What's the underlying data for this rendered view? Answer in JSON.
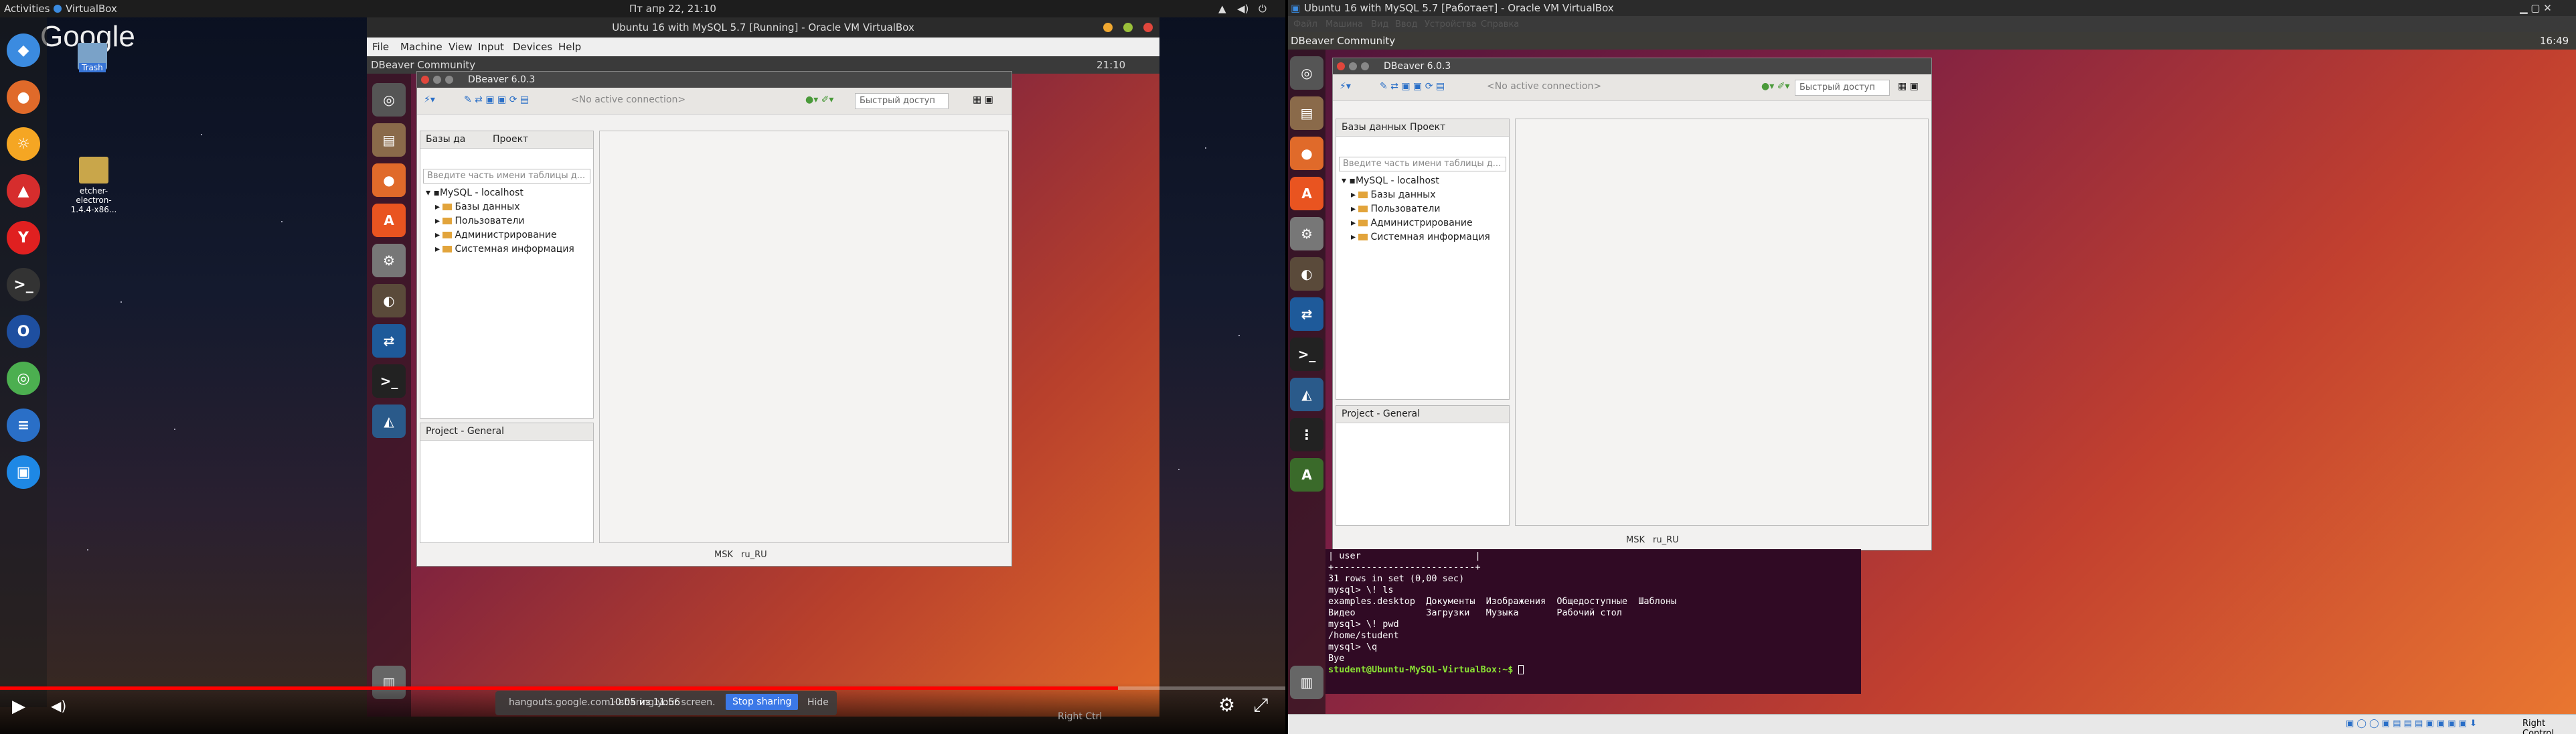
{
  "host_topbar": {
    "activities": "Activities",
    "app": "VirtualBox",
    "clock": "Пт апр 22, 21:10"
  },
  "desktop": {
    "google": "Google",
    "trash_label": "Trash",
    "file_label": "etcher-electron-1.4.4-x86..."
  },
  "vbox_left": {
    "title": "Ubuntu 16 with MySQL 5.7 [Running] - Oracle VM VirtualBox",
    "menu": [
      "File",
      "Machine",
      "View",
      "Input",
      "Devices",
      "Help"
    ],
    "host_key": "Right Ctrl"
  },
  "guest_left": {
    "app": "DBeaver Community",
    "time": "21:10"
  },
  "dbeaver": {
    "title": "DBeaver 6.0.3",
    "connection": "<No active connection>",
    "quick_access": "Быстрый доступ",
    "tab_db": "Базы данных",
    "tab_db_short": "Базы да",
    "tab_project": "Проект",
    "filter_placeholder": "Введите часть имени таблицы д...",
    "filter_placeholder_right": "Введите часть имени таблицы д...",
    "project_general": "Project - General",
    "tree": {
      "root": "MySQL - localhost",
      "items": [
        "Базы данных",
        "Пользователи",
        "Администрирование",
        "Системная информация"
      ]
    },
    "status": {
      "tz": "MSK",
      "locale": "ru_RU"
    }
  },
  "youtube": {
    "time": "10:05 из 11:56",
    "progress": 0.87,
    "share_text": "hangouts.google.com · sharing your screen.",
    "stop_sharing": "Stop sharing",
    "hide": "Hide"
  },
  "right_vbox": {
    "title": "Ubuntu 16 with MySQL 5.7 [Работает] - Oracle VM VirtualBox",
    "menu": [
      "Файл",
      "Машина",
      "Вид",
      "Ввод",
      "Устройства",
      "Справка"
    ],
    "app": "DBeaver Community",
    "time": "16:49",
    "host_key": "Right Control"
  },
  "terminal": {
    "lines": [
      "| user                     |",
      "+--------------------------+",
      "31 rows in set (0,00 sec)",
      "",
      "mysql> \\! ls",
      "examples.desktop  Документы  Изображения  Общедоступные  Шаблоны",
      "Видео             Загрузки   Музыка       Рабочий стол",
      "mysql> \\! pwd",
      "/home/student",
      "mysql> \\q",
      "Bye"
    ],
    "prompt": "student@Ubuntu-MySQL-VirtualBox:~$ "
  },
  "colors": {
    "ubuntu_orange": "#e95420",
    "terminal_bg": "#300a24",
    "prompt_green": "#8ae234"
  }
}
